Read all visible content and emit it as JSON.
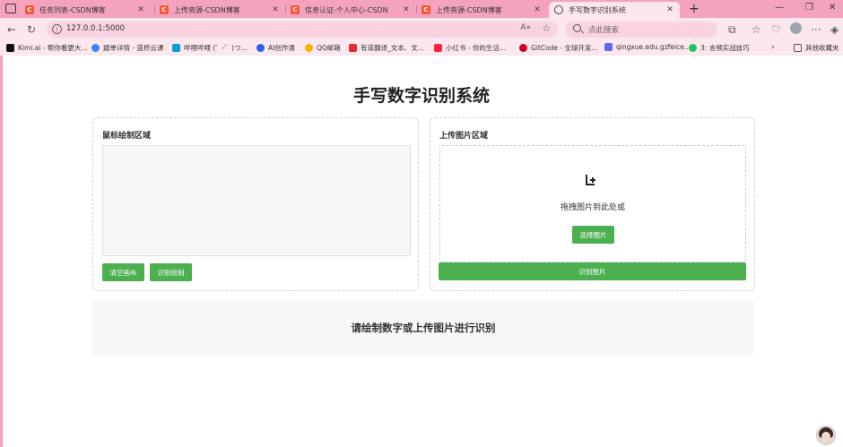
{
  "browser": {
    "tabs": [
      {
        "title": "任务列表-CSDN博客",
        "favicon": "C",
        "active": false
      },
      {
        "title": "上传资源-CSDN博客",
        "favicon": "C",
        "active": false
      },
      {
        "title": "信息认证-个人中心-CSDN",
        "favicon": "C",
        "active": false
      },
      {
        "title": "上传资源-CSDN博客",
        "favicon": "C",
        "active": false
      },
      {
        "title": "手写数字识别系统",
        "favicon": "globe",
        "active": true
      }
    ],
    "url": "127.0.0.1:5000",
    "search_placeholder": "点此搜索",
    "bookmarks": [
      {
        "label": "Kimi.ai - 帮你看更大...",
        "color": "#111111"
      },
      {
        "label": "题单详情 - 蓝桥云课",
        "color": "#3b82f6"
      },
      {
        "label": "哔哩哔哩 (゜-゜)つ...",
        "color": "#00a1d6"
      },
      {
        "label": "AI创作通",
        "color": "#2563eb"
      },
      {
        "label": "QQ邮箱",
        "color": "#f5b400"
      },
      {
        "label": "有道翻译_文本、文...",
        "color": "#e02d2d"
      },
      {
        "label": "小红书 - 你的生活...",
        "color": "#ff2442"
      },
      {
        "label": "GitCode - 全球开发...",
        "color": "#d0021b"
      },
      {
        "label": "qingxue.edu.gzfeice...",
        "color": "#6366f1"
      },
      {
        "label": "3: 言频实战技巧",
        "color": "#22c55e"
      },
      {
        "label": "其他收藏夹",
        "color": "#555555"
      }
    ]
  },
  "page": {
    "title": "手写数字识别系统",
    "draw_panel": {
      "title": "鼠标绘制区域",
      "clear_button": "清空画布",
      "recognize_button": "识别绘制"
    },
    "upload_panel": {
      "title": "上传图片区域",
      "drop_text": "拖拽图片到此处或",
      "choose_button": "选择图片",
      "recognize_button": "识别图片"
    },
    "result_text": "请绘制数字或上传图片进行识别"
  },
  "colors": {
    "accent": "#4caf50",
    "browser_chrome": "#f4a3bf"
  }
}
